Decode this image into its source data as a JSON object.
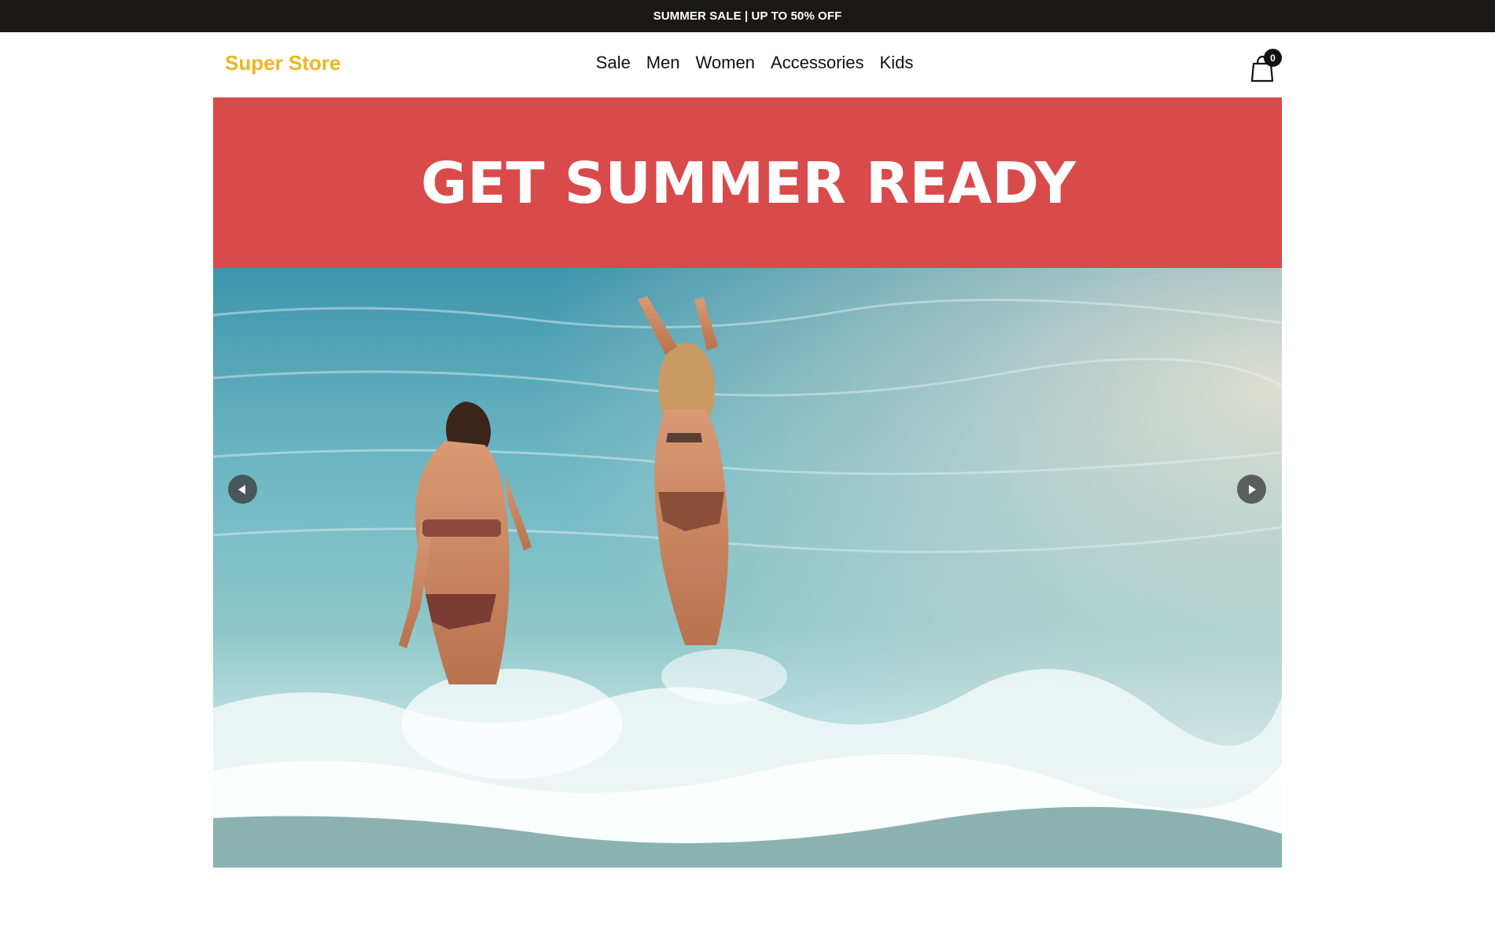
{
  "announcement": {
    "text": "SUMMER SALE | UP TO 50% OFF"
  },
  "header": {
    "logo": "Super Store",
    "nav": [
      {
        "label": "Sale"
      },
      {
        "label": "Men"
      },
      {
        "label": "Women"
      },
      {
        "label": "Accessories"
      },
      {
        "label": "Kids"
      }
    ],
    "cart": {
      "icon": "shopping-bag-icon",
      "count": "0"
    }
  },
  "hero": {
    "headline": "GET SUMMER READY",
    "image_description": "",
    "prev_icon": "chevron-left-icon",
    "next_icon": "chevron-right-icon"
  },
  "colors": {
    "announcement_bg": "#1a1918",
    "logo": "#f0b51f",
    "promo_bg": "#d94a4b"
  }
}
